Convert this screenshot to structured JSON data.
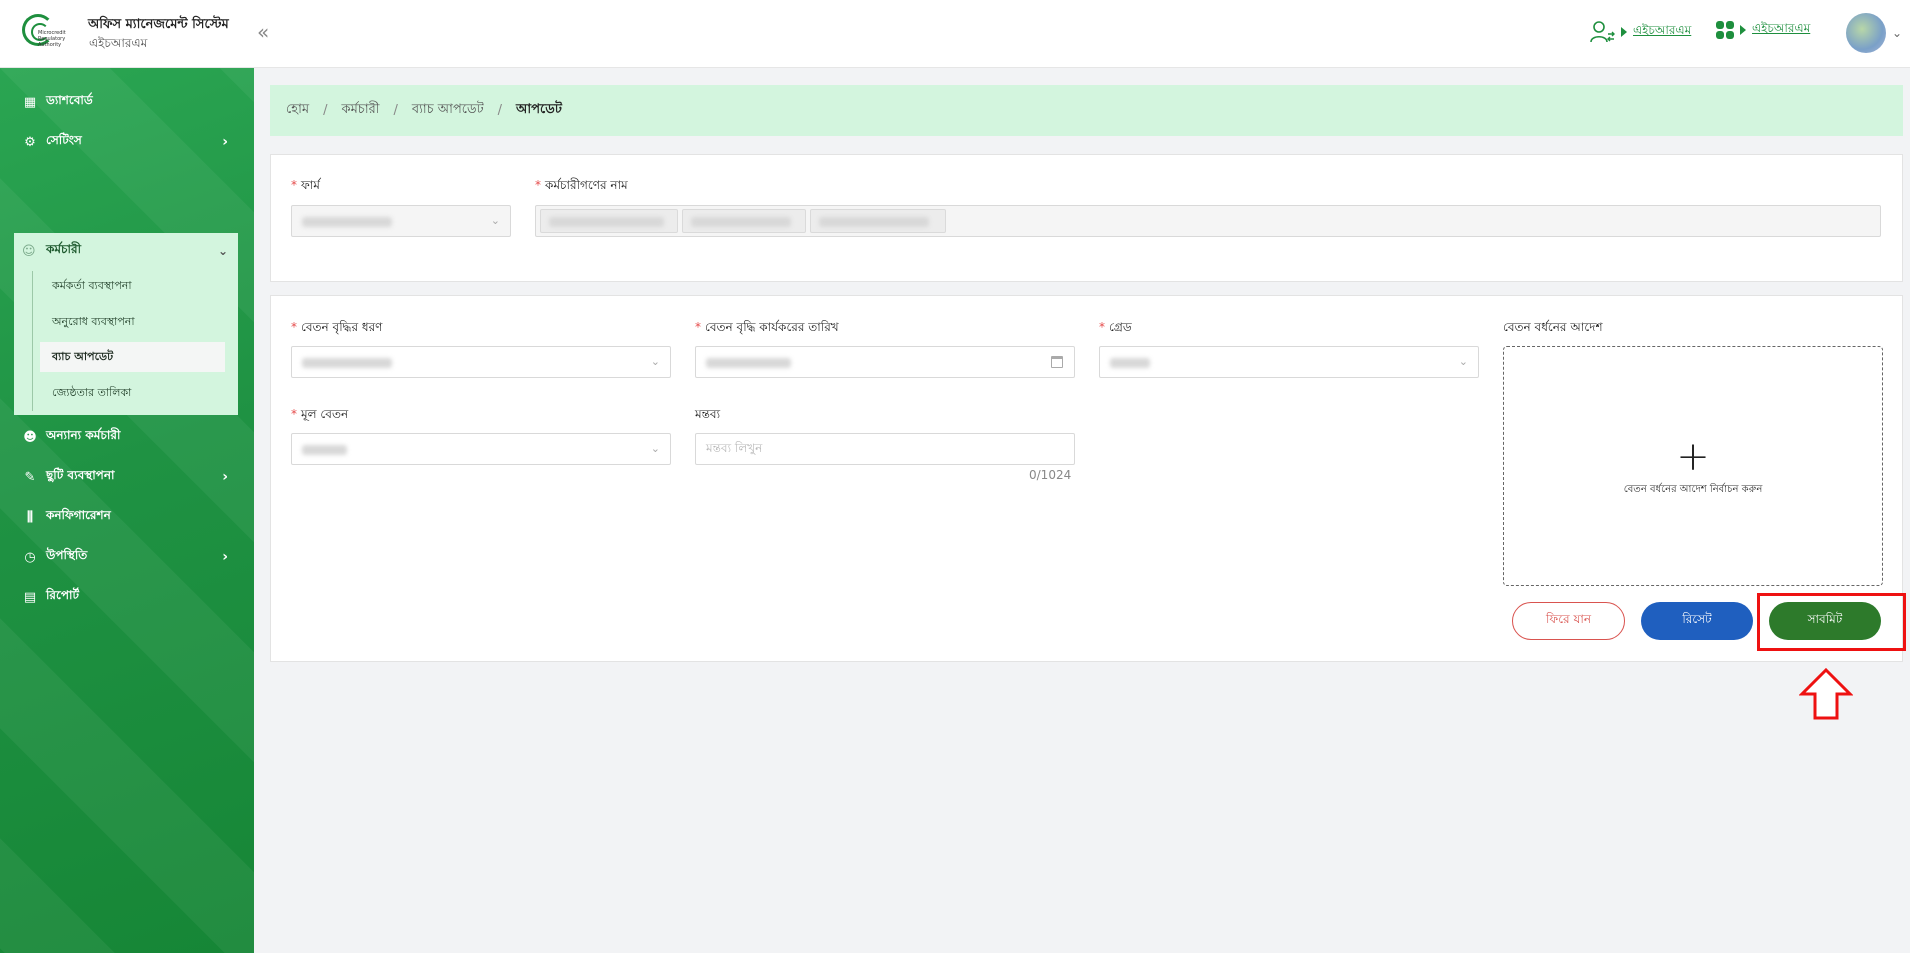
{
  "header": {
    "logo_text": "Microcredit Regulatory Authority",
    "title": "অফিস ম্যানেজমেন্ট সিস্টেম",
    "subtitle": "এইচআরএম",
    "collapse_label": "«",
    "role_link": "এইচআরএম",
    "app_link": "এইচআরএম"
  },
  "sidebar": {
    "items": [
      {
        "label": "ড্যাশবোর্ড",
        "icon": "dashboard-icon"
      },
      {
        "label": "সেটিংস",
        "icon": "gear-icon"
      },
      {
        "label": "কর্মচারী",
        "icon": "employee-icon"
      },
      {
        "label": "অন্যান্য কর্মচারী",
        "icon": "users-icon"
      },
      {
        "label": "ছুটি ব্যবস্থাপনা",
        "icon": "leave-icon"
      },
      {
        "label": "কনফিগারেশন",
        "icon": "sliders-icon"
      },
      {
        "label": "উপস্থিতি",
        "icon": "clock-icon"
      },
      {
        "label": "রিপোর্ট",
        "icon": "report-icon"
      }
    ],
    "sub_items": [
      "কর্মকর্তা ব্যবস্থাপনা",
      "অনুরোধ ব্যবস্থাপনা",
      "ব্যাচ আপডেট",
      "জ্যেষ্ঠতার তালিকা"
    ]
  },
  "breadcrumb": [
    "হোম",
    "কর্মচারী",
    "ব্যাচ আপডেট",
    "আপডেট"
  ],
  "form": {
    "firm_label": "ফার্ম",
    "employees_label": "কর্মচারীগণের নাম",
    "increment_type_label": "বেতন বৃদ্ধির ধরণ",
    "effective_date_label": "বেতন বৃদ্ধি কার্যকরের তারিখ",
    "grade_label": "গ্রেড",
    "order_label": "বেতন বর্ধনের আদেশ",
    "basic_salary_label": "মূল বেতন",
    "comment_label": "মন্তব্য",
    "comment_placeholder": "মন্তব্য লিখুন",
    "comment_counter": "0/1024",
    "upload_text": "বেতন বর্ধনের আদেশ নির্বাচন করুন"
  },
  "buttons": {
    "back": "ফিরে যান",
    "reset": "রিসেট",
    "submit": "সাবমিট"
  }
}
